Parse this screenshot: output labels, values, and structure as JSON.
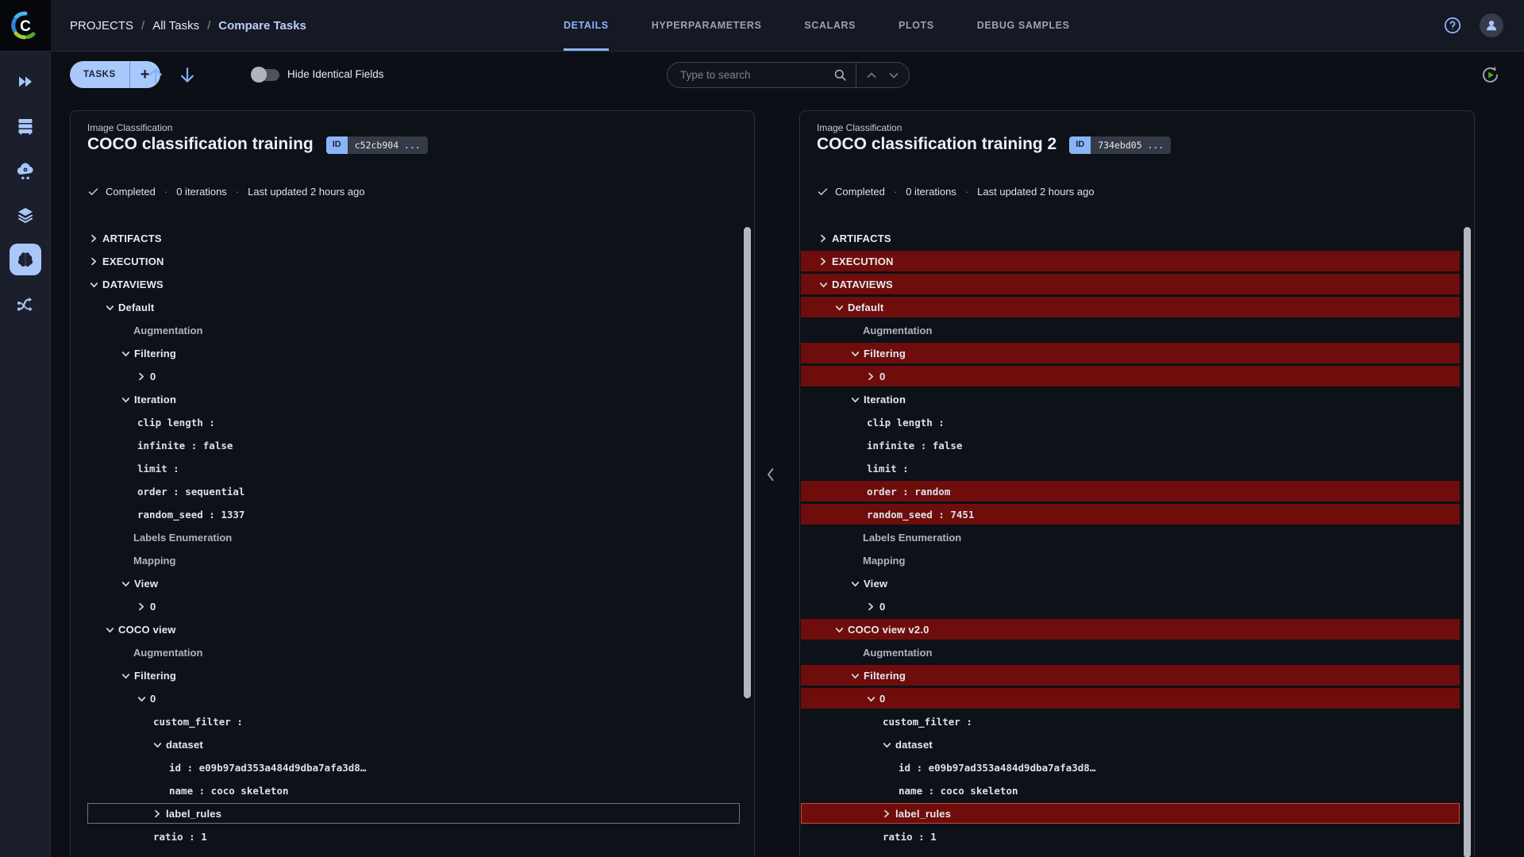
{
  "app": {
    "name": "ClearML"
  },
  "header": {
    "breadcrumbs": [
      {
        "label": "PROJECTS",
        "current": false
      },
      {
        "label": "All Tasks",
        "current": false
      },
      {
        "label": "Compare Tasks",
        "current": true
      }
    ],
    "tabs": [
      {
        "label": "DETAILS",
        "active": true
      },
      {
        "label": "HYPERPARAMETERS",
        "active": false
      },
      {
        "label": "SCALARS",
        "active": false
      },
      {
        "label": "PLOTS",
        "active": false
      },
      {
        "label": "DEBUG SAMPLES",
        "active": false
      }
    ],
    "help_icon": "help-icon",
    "avatar_icon": "user-avatar"
  },
  "toolbar": {
    "tasks_button": "TASKS",
    "add_button": "+",
    "prev_icon": "arrow-up-icon",
    "next_icon": "arrow-down-icon",
    "toggle_label": "Hide Identical Fields",
    "toggle_on": false,
    "search": {
      "placeholder": "Type to search",
      "icon": "search-icon",
      "prev_icon": "chevron-up-icon",
      "next_icon": "chevron-down-icon"
    },
    "refresh_icon": "auto-refresh-icon"
  },
  "sidebar": {
    "items": [
      {
        "name": "sidebar-icon-quickstart",
        "icon": "play-double",
        "active": false
      },
      {
        "name": "sidebar-icon-workers",
        "icon": "server",
        "active": false
      },
      {
        "name": "sidebar-icon-cloud",
        "icon": "cloud-gear",
        "active": false
      },
      {
        "name": "sidebar-icon-datasets",
        "icon": "layers",
        "active": false
      },
      {
        "name": "sidebar-icon-hyperdatasets",
        "icon": "brain",
        "active": true
      },
      {
        "name": "sidebar-icon-pipelines",
        "icon": "pipeline",
        "active": false
      }
    ]
  },
  "collapse_handle_icon": "chevron-left-icon",
  "panels": [
    {
      "project": "Image Classification",
      "title": "COCO classification training",
      "id_label": "ID",
      "id_value": "c52cb904 ...",
      "status": "Completed",
      "status_icon": "check-icon",
      "iterations": "0 iterations",
      "updated": "Last updated 2 hours ago",
      "tree": [
        {
          "level": 0,
          "chev": "right",
          "label": "ARTIFACTS",
          "style": "section"
        },
        {
          "level": 0,
          "chev": "right",
          "label": "EXECUTION",
          "style": "section"
        },
        {
          "level": 0,
          "chev": "down",
          "label": "DATAVIEWS",
          "style": "section"
        },
        {
          "level": 1,
          "chev": "down",
          "label": "Default",
          "style": "node"
        },
        {
          "level": 2,
          "chev": null,
          "label": "Augmentation",
          "style": "plain"
        },
        {
          "level": 2,
          "chev": "down",
          "label": "Filtering",
          "style": "node"
        },
        {
          "level": 3,
          "chev": "right",
          "label": "0",
          "style": "node"
        },
        {
          "level": 2,
          "chev": "down",
          "label": "Iteration",
          "style": "node"
        },
        {
          "level": 3,
          "chev": null,
          "label": "clip length :",
          "style": "kv"
        },
        {
          "level": 3,
          "chev": null,
          "label": "infinite : false",
          "style": "kv"
        },
        {
          "level": 3,
          "chev": null,
          "label": "limit :",
          "style": "kv"
        },
        {
          "level": 3,
          "chev": null,
          "label": "order : sequential",
          "style": "kv"
        },
        {
          "level": 3,
          "chev": null,
          "label": "random_seed : 1337",
          "style": "kv"
        },
        {
          "level": 2,
          "chev": null,
          "label": "Labels Enumeration",
          "style": "plain"
        },
        {
          "level": 2,
          "chev": null,
          "label": "Mapping",
          "style": "plain"
        },
        {
          "level": 2,
          "chev": "down",
          "label": "View",
          "style": "node"
        },
        {
          "level": 3,
          "chev": "right",
          "label": "0",
          "style": "node"
        },
        {
          "level": 1,
          "chev": "down",
          "label": "COCO view",
          "style": "node"
        },
        {
          "level": 2,
          "chev": null,
          "label": "Augmentation",
          "style": "plain"
        },
        {
          "level": 2,
          "chev": "down",
          "label": "Filtering",
          "style": "node"
        },
        {
          "level": 3,
          "chev": "down",
          "label": "0",
          "style": "node"
        },
        {
          "level": 4,
          "chev": null,
          "label": "custom_filter :",
          "style": "kv"
        },
        {
          "level": 4,
          "chev": "down",
          "label": "dataset",
          "style": "node"
        },
        {
          "level": 5,
          "chev": null,
          "label": "id : e09b97ad353a484d9dba7afa3d8…",
          "style": "kv"
        },
        {
          "level": 5,
          "chev": null,
          "label": "name : coco skeleton",
          "style": "kv"
        },
        {
          "level": 4,
          "chev": "right",
          "label": "label_rules",
          "style": "node",
          "boxed": true
        },
        {
          "level": 4,
          "chev": null,
          "label": "ratio : 1",
          "style": "kv"
        }
      ]
    },
    {
      "project": "Image Classification",
      "title": "COCO classification training 2",
      "id_label": "ID",
      "id_value": "734ebd05 ...",
      "status": "Completed",
      "status_icon": "check-icon",
      "iterations": "0 iterations",
      "updated": "Last updated 2 hours ago",
      "tree": [
        {
          "level": 0,
          "chev": "right",
          "label": "ARTIFACTS",
          "style": "section"
        },
        {
          "level": 0,
          "chev": "right",
          "label": "EXECUTION",
          "style": "section",
          "diff": true
        },
        {
          "level": 0,
          "chev": "down",
          "label": "DATAVIEWS",
          "style": "section",
          "diff": true
        },
        {
          "level": 1,
          "chev": "down",
          "label": "Default",
          "style": "node",
          "diff": true
        },
        {
          "level": 2,
          "chev": null,
          "label": "Augmentation",
          "style": "plain"
        },
        {
          "level": 2,
          "chev": "down",
          "label": "Filtering",
          "style": "node",
          "diff": true
        },
        {
          "level": 3,
          "chev": "right",
          "label": "0",
          "style": "node",
          "diff": true
        },
        {
          "level": 2,
          "chev": "down",
          "label": "Iteration",
          "style": "node"
        },
        {
          "level": 3,
          "chev": null,
          "label": "clip length :",
          "style": "kv"
        },
        {
          "level": 3,
          "chev": null,
          "label": "infinite : false",
          "style": "kv"
        },
        {
          "level": 3,
          "chev": null,
          "label": "limit :",
          "style": "kv"
        },
        {
          "level": 3,
          "chev": null,
          "label": "order : random",
          "style": "kv",
          "diff": true
        },
        {
          "level": 3,
          "chev": null,
          "label": "random_seed : 7451",
          "style": "kv",
          "diff": true
        },
        {
          "level": 2,
          "chev": null,
          "label": "Labels Enumeration",
          "style": "plain"
        },
        {
          "level": 2,
          "chev": null,
          "label": "Mapping",
          "style": "plain"
        },
        {
          "level": 2,
          "chev": "down",
          "label": "View",
          "style": "node"
        },
        {
          "level": 3,
          "chev": "right",
          "label": "0",
          "style": "node"
        },
        {
          "level": 1,
          "chev": "down",
          "label": "COCO view v2.0",
          "style": "node",
          "diff": true
        },
        {
          "level": 2,
          "chev": null,
          "label": "Augmentation",
          "style": "plain"
        },
        {
          "level": 2,
          "chev": "down",
          "label": "Filtering",
          "style": "node",
          "diff": true
        },
        {
          "level": 3,
          "chev": "down",
          "label": "0",
          "style": "node",
          "diff": true
        },
        {
          "level": 4,
          "chev": null,
          "label": "custom_filter :",
          "style": "kv"
        },
        {
          "level": 4,
          "chev": "down",
          "label": "dataset",
          "style": "node"
        },
        {
          "level": 5,
          "chev": null,
          "label": "id : e09b97ad353a484d9dba7afa3d8…",
          "style": "kv"
        },
        {
          "level": 5,
          "chev": null,
          "label": "name : coco skeleton",
          "style": "kv"
        },
        {
          "level": 4,
          "chev": "right",
          "label": "label_rules",
          "style": "node",
          "boxed": true,
          "diff": true
        },
        {
          "level": 4,
          "chev": null,
          "label": "ratio : 1",
          "style": "kv"
        }
      ]
    }
  ],
  "colors": {
    "accent": "#8ab4f8",
    "diff_background": "#6e0d0c",
    "diff_border": "#c4473f",
    "page_background": "#0c0f15",
    "card_border": "#2b303d",
    "tasks_button_background": "#a9c8fb"
  }
}
